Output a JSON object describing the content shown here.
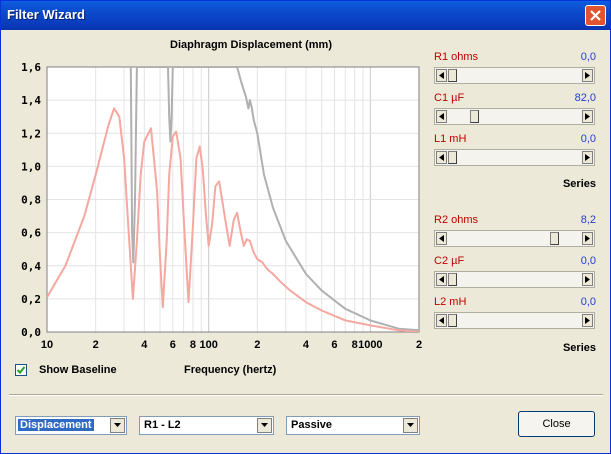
{
  "window": {
    "title": "Filter Wizard"
  },
  "chart": {
    "title": "Diaphragm Displacement (mm)",
    "xlabel": "Frequency (hertz)"
  },
  "chart_data": {
    "type": "line",
    "title": "Diaphragm Displacement (mm)",
    "xlabel": "Frequency (hertz)",
    "ylabel": "",
    "xscale": "log",
    "xlim": [
      10,
      2000
    ],
    "ylim": [
      0,
      1.6
    ],
    "grid": true,
    "y_ticks": [
      "0,0",
      "0,2",
      "0,4",
      "0,6",
      "0,8",
      "1,0",
      "1,2",
      "1,4",
      "1,6"
    ],
    "x_ticks": [
      "10",
      "2",
      "4",
      "6",
      "8",
      "100",
      "2",
      "4",
      "6",
      "8",
      "1000",
      "2"
    ],
    "series": [
      {
        "color": "#f4a8a0",
        "x": [
          10,
          13,
          17,
          20,
          24,
          26,
          28,
          30,
          32,
          34,
          36,
          38,
          40,
          44,
          48,
          50,
          52,
          55,
          57,
          60,
          63,
          67,
          70,
          75,
          80,
          84,
          88,
          92,
          96,
          100,
          105,
          110,
          116,
          122,
          128,
          135,
          143,
          150,
          158,
          165,
          172,
          180,
          190,
          200,
          215,
          230,
          250,
          280,
          320,
          400,
          500,
          700,
          1000,
          1500,
          2000
        ],
        "y": [
          0.21,
          0.4,
          0.7,
          0.95,
          1.25,
          1.35,
          1.3,
          1.05,
          0.6,
          0.2,
          0.55,
          0.95,
          1.15,
          1.23,
          0.85,
          0.45,
          0.15,
          0.55,
          0.95,
          1.18,
          1.21,
          1.05,
          0.7,
          0.18,
          0.65,
          1.05,
          1.12,
          0.98,
          0.72,
          0.52,
          0.65,
          0.88,
          0.91,
          0.78,
          0.65,
          0.52,
          0.68,
          0.72,
          0.6,
          0.52,
          0.56,
          0.55,
          0.48,
          0.44,
          0.42,
          0.38,
          0.35,
          0.3,
          0.25,
          0.18,
          0.13,
          0.07,
          0.04,
          0.01,
          0.0
        ]
      },
      {
        "color": "#b0b0b0",
        "x": [
          33,
          33.6,
          34.2,
          35,
          36,
          56,
          57,
          58,
          59,
          60,
          150,
          160,
          170,
          176,
          180,
          185,
          190,
          200,
          220,
          250,
          300,
          400,
          500,
          700,
          1000,
          1500,
          2000
        ],
        "y": [
          1.6,
          0.6,
          0.42,
          0.8,
          1.6,
          1.6,
          1.3,
          1.15,
          1.3,
          1.6,
          1.6,
          1.5,
          1.42,
          1.35,
          1.4,
          1.35,
          1.28,
          1.2,
          0.95,
          0.75,
          0.55,
          0.35,
          0.25,
          0.14,
          0.07,
          0.02,
          0.01
        ]
      }
    ]
  },
  "params": [
    {
      "label": "R1  ohms",
      "value": "0,0",
      "level": 0.0
    },
    {
      "label": "C1  µF",
      "value": "82,0",
      "level": 0.18
    },
    {
      "label": "L1  mH",
      "value": "0,0",
      "level": 0.0
    },
    {
      "label": "R2  ohms",
      "value": "8,2",
      "level": 0.82
    },
    {
      "label": "C2  µF",
      "value": "0,0",
      "level": 0.0
    },
    {
      "label": "L2  mH",
      "value": "0,0",
      "level": 0.0
    }
  ],
  "series_label_1": "Series",
  "series_label_2": "Series",
  "show_baseline": {
    "label": "Show Baseline",
    "checked": true
  },
  "combos": {
    "mode": "Displacement",
    "pair": "R1 - L2",
    "type": "Passive"
  },
  "close_button": "Close"
}
